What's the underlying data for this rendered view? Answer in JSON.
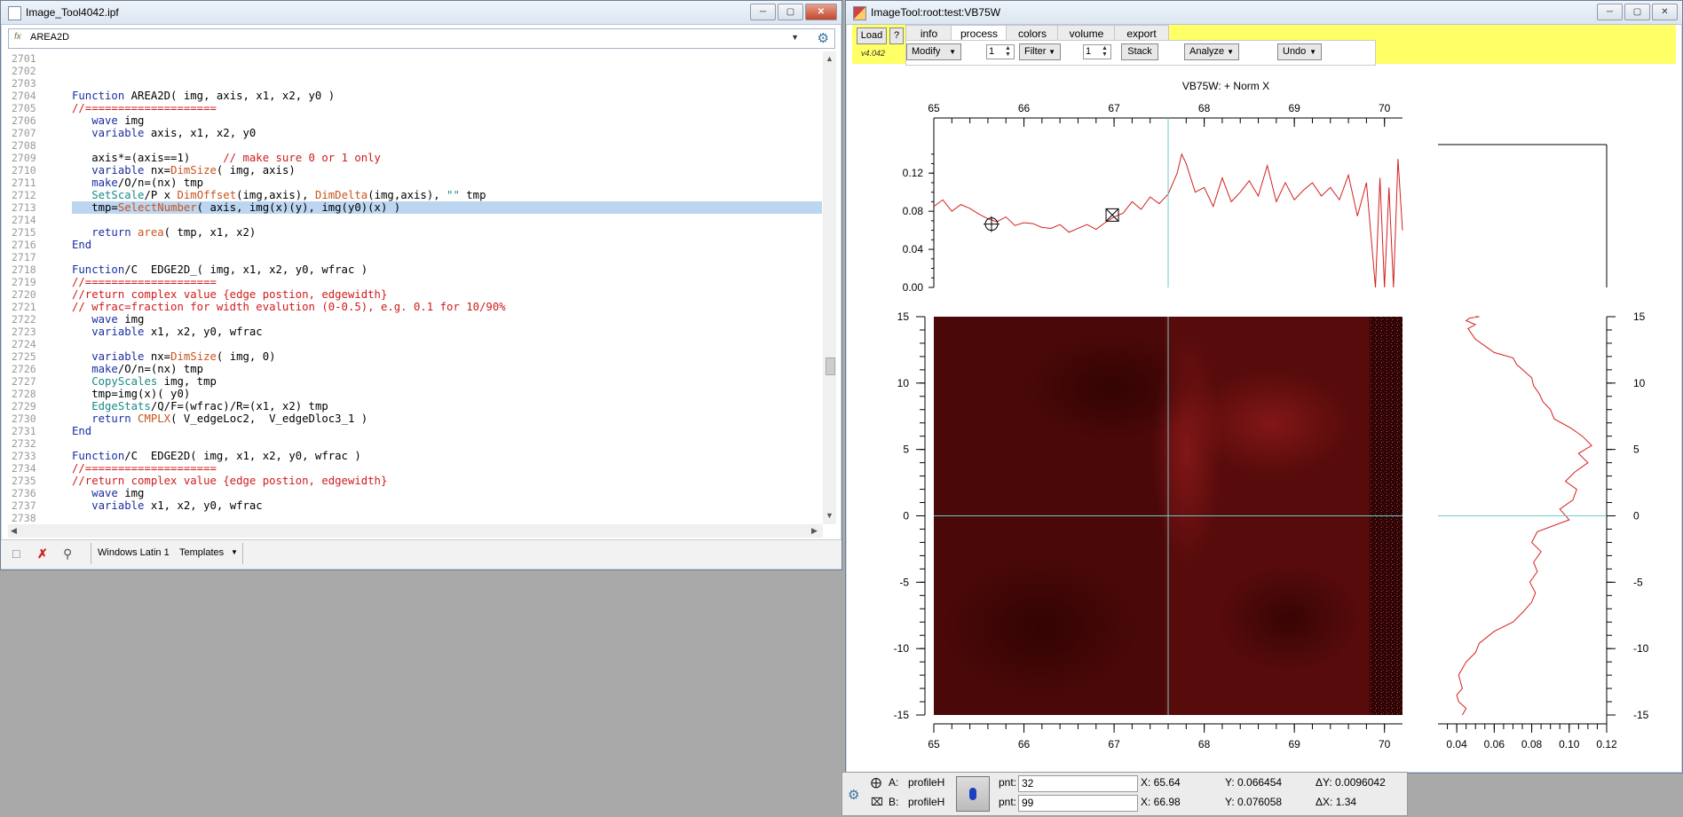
{
  "procedure_window": {
    "title": "Image_Tool4042.ipf",
    "function_selector": {
      "fx_label": "fx",
      "value": "AREA2D"
    },
    "lines": [
      {
        "n": "2701",
        "segs": []
      },
      {
        "n": "2702",
        "segs": []
      },
      {
        "n": "2703",
        "segs": []
      },
      {
        "n": "2704",
        "segs": [
          {
            "t": "Function",
            "c": "kw"
          },
          {
            "t": " AREA2D( img, axis, x1, x2, y0 )"
          }
        ]
      },
      {
        "n": "2705",
        "segs": [
          {
            "t": "//====================",
            "c": "cm"
          }
        ]
      },
      {
        "n": "2706",
        "segs": [
          {
            "t": "   "
          },
          {
            "t": "wave",
            "c": "kw"
          },
          {
            "t": " img"
          }
        ]
      },
      {
        "n": "2707",
        "segs": [
          {
            "t": "   "
          },
          {
            "t": "variable",
            "c": "kw"
          },
          {
            "t": " axis, x1, x2, y0"
          }
        ]
      },
      {
        "n": "2708",
        "segs": []
      },
      {
        "n": "2709",
        "segs": [
          {
            "t": "   axis*=(axis==1)     "
          },
          {
            "t": "// make sure 0 or 1 only",
            "c": "cm"
          }
        ]
      },
      {
        "n": "2710",
        "segs": [
          {
            "t": "   "
          },
          {
            "t": "variable",
            "c": "kw"
          },
          {
            "t": " nx="
          },
          {
            "t": "DimSize",
            "c": "fn"
          },
          {
            "t": "( img, axis)"
          }
        ]
      },
      {
        "n": "2711",
        "segs": [
          {
            "t": "   "
          },
          {
            "t": "make",
            "c": "kw"
          },
          {
            "t": "/O/n=(nx) tmp"
          }
        ]
      },
      {
        "n": "2712",
        "segs": [
          {
            "t": "   "
          },
          {
            "t": "SetScale",
            "c": "fn2"
          },
          {
            "t": "/P x "
          },
          {
            "t": "DimOffset",
            "c": "fn"
          },
          {
            "t": "(img,axis), "
          },
          {
            "t": "DimDelta",
            "c": "fn"
          },
          {
            "t": "(img,axis), "
          },
          {
            "t": "\"\"",
            "c": "fn2"
          },
          {
            "t": " tmp"
          }
        ]
      },
      {
        "n": "2713",
        "hl": true,
        "segs": [
          {
            "t": "   tmp="
          },
          {
            "t": "SelectNumber",
            "c": "fn"
          },
          {
            "t": "( axis, img(x)(y), img(y0)(x) )"
          }
        ]
      },
      {
        "n": "2714",
        "segs": []
      },
      {
        "n": "2715",
        "segs": [
          {
            "t": "   "
          },
          {
            "t": "return",
            "c": "kw"
          },
          {
            "t": " "
          },
          {
            "t": "area",
            "c": "fn"
          },
          {
            "t": "( tmp, x1, x2)"
          }
        ]
      },
      {
        "n": "2716",
        "segs": [
          {
            "t": "End",
            "c": "kw"
          }
        ]
      },
      {
        "n": "2717",
        "segs": []
      },
      {
        "n": "2718",
        "segs": [
          {
            "t": "Function",
            "c": "kw"
          },
          {
            "t": "/C  EDGE2D_( img, x1, x2, y0, wfrac )"
          }
        ]
      },
      {
        "n": "2719",
        "segs": [
          {
            "t": "//====================",
            "c": "cm"
          }
        ]
      },
      {
        "n": "2720",
        "segs": [
          {
            "t": "//return complex value {edge postion, edgewidth}",
            "c": "cm"
          }
        ]
      },
      {
        "n": "2721",
        "segs": [
          {
            "t": "// wfrac=fraction for width evalution (0-0.5), e.g. 0.1 for 10/90%",
            "c": "cm"
          }
        ]
      },
      {
        "n": "2722",
        "segs": [
          {
            "t": "   "
          },
          {
            "t": "wave",
            "c": "kw"
          },
          {
            "t": " img"
          }
        ]
      },
      {
        "n": "2723",
        "segs": [
          {
            "t": "   "
          },
          {
            "t": "variable",
            "c": "kw"
          },
          {
            "t": " x1, x2, y0, wfrac"
          }
        ]
      },
      {
        "n": "2724",
        "segs": []
      },
      {
        "n": "2725",
        "segs": [
          {
            "t": "   "
          },
          {
            "t": "variable",
            "c": "kw"
          },
          {
            "t": " nx="
          },
          {
            "t": "DimSize",
            "c": "fn"
          },
          {
            "t": "( img, 0)"
          }
        ]
      },
      {
        "n": "2726",
        "segs": [
          {
            "t": "   "
          },
          {
            "t": "make",
            "c": "kw"
          },
          {
            "t": "/O/n=(nx) tmp"
          }
        ]
      },
      {
        "n": "2727",
        "segs": [
          {
            "t": "   "
          },
          {
            "t": "CopyScales",
            "c": "fn2"
          },
          {
            "t": " img, tmp"
          }
        ]
      },
      {
        "n": "2728",
        "segs": [
          {
            "t": "   tmp=img(x)( y0)"
          }
        ]
      },
      {
        "n": "2729",
        "segs": [
          {
            "t": "   "
          },
          {
            "t": "EdgeStats",
            "c": "fn2"
          },
          {
            "t": "/Q/F=(wfrac)/R=(x1, x2) tmp"
          }
        ]
      },
      {
        "n": "2730",
        "segs": [
          {
            "t": "   "
          },
          {
            "t": "return",
            "c": "kw"
          },
          {
            "t": " "
          },
          {
            "t": "CMPLX",
            "c": "fn"
          },
          {
            "t": "( V_edgeLoc2,  V_edgeDloc3_1 )"
          }
        ]
      },
      {
        "n": "2731",
        "segs": [
          {
            "t": "End",
            "c": "kw"
          }
        ]
      },
      {
        "n": "2732",
        "segs": []
      },
      {
        "n": "2733",
        "segs": [
          {
            "t": "Function",
            "c": "kw"
          },
          {
            "t": "/C  EDGE2D( img, x1, x2, y0, wfrac )"
          }
        ]
      },
      {
        "n": "2734",
        "segs": [
          {
            "t": "//====================",
            "c": "cm"
          }
        ]
      },
      {
        "n": "2735",
        "segs": [
          {
            "t": "//return complex value {edge postion, edgewidth}",
            "c": "cm"
          }
        ]
      },
      {
        "n": "2736",
        "segs": [
          {
            "t": "   "
          },
          {
            "t": "wave",
            "c": "kw"
          },
          {
            "t": " img"
          }
        ]
      },
      {
        "n": "2737",
        "segs": [
          {
            "t": "   "
          },
          {
            "t": "variable",
            "c": "kw"
          },
          {
            "t": " x1, x2, y0, wfrac"
          }
        ]
      },
      {
        "n": "2738",
        "segs": []
      }
    ],
    "status": {
      "encoding": "Windows Latin 1",
      "templates": "Templates"
    }
  },
  "image_tool": {
    "title": "ImageTool:root:test:VB75W",
    "load_label": "Load",
    "help_label": "?",
    "version": "v4.042",
    "tabs": [
      "info",
      "process",
      "colors",
      "volume",
      "export"
    ],
    "active_tab": "process",
    "modify_label": "Modify",
    "spin1_value": "1",
    "filter_label": "Filter",
    "spin2_value": "1",
    "stack_label": "Stack",
    "analyze_label": "Analyze",
    "undo_label": "Undo",
    "plot_title": "VB75W: + Norm X",
    "cursor_color": "#66cccc",
    "trace_color": "#d42020"
  },
  "readout": {
    "rows": [
      {
        "cursor": "A:",
        "wave": "profileH",
        "pnt_label": "pnt:",
        "pnt": "32",
        "x": "X: 65.64",
        "y": "Y: 0.066454",
        "delta": "ΔY: 0.0096042"
      },
      {
        "cursor": "B:",
        "wave": "profileH",
        "pnt_label": "pnt:",
        "pnt": "99",
        "x": "X: 66.98",
        "y": "Y: 0.076058",
        "delta": "ΔX: 1.34"
      }
    ]
  },
  "chart_data": [
    {
      "type": "line",
      "name": "horizontal-profile",
      "x_ticks": [
        65,
        66,
        67,
        68,
        69,
        70
      ],
      "y_ticks": [
        0.0,
        0.04,
        0.08,
        0.12
      ],
      "y_tick_labels": [
        "0.00",
        "0.04",
        "0.08",
        "0.12"
      ],
      "xlim": [
        65,
        70.2
      ],
      "ylim": [
        0,
        0.15
      ],
      "x": [
        65.0,
        65.1,
        65.2,
        65.3,
        65.4,
        65.5,
        65.6,
        65.7,
        65.8,
        65.9,
        66.0,
        66.1,
        66.2,
        66.3,
        66.4,
        66.5,
        66.6,
        66.7,
        66.8,
        66.9,
        67.0,
        67.1,
        67.2,
        67.3,
        67.4,
        67.5,
        67.6,
        67.7,
        67.75,
        67.8,
        67.9,
        68.0,
        68.1,
        68.2,
        68.3,
        68.4,
        68.5,
        68.6,
        68.7,
        68.8,
        68.9,
        69.0,
        69.1,
        69.2,
        69.3,
        69.4,
        69.5,
        69.6,
        69.7,
        69.8,
        69.9,
        69.95,
        70.0,
        70.05,
        70.1,
        70.15,
        70.2
      ],
      "y": [
        0.085,
        0.092,
        0.08,
        0.087,
        0.083,
        0.077,
        0.072,
        0.069,
        0.074,
        0.065,
        0.068,
        0.067,
        0.063,
        0.062,
        0.066,
        0.058,
        0.062,
        0.066,
        0.061,
        0.068,
        0.074,
        0.078,
        0.09,
        0.082,
        0.095,
        0.088,
        0.098,
        0.12,
        0.14,
        0.13,
        0.1,
        0.105,
        0.085,
        0.115,
        0.09,
        0.1,
        0.112,
        0.096,
        0.128,
        0.09,
        0.11,
        0.092,
        0.102,
        0.11,
        0.096,
        0.105,
        0.092,
        0.118,
        0.075,
        0.11,
        0.0,
        0.115,
        0.0,
        0.105,
        0.0,
        0.135,
        0.06
      ],
      "cursor_a": {
        "x": 65.64,
        "y": 0.066454
      },
      "cursor_b": {
        "x": 66.98,
        "y": 0.076058
      },
      "crosshair_x": 67.6
    },
    {
      "type": "heatmap",
      "name": "image",
      "x_ticks": [
        65,
        66,
        67,
        68,
        69,
        70
      ],
      "y_ticks": [
        -15,
        -10,
        -5,
        0,
        5,
        10,
        15
      ],
      "xlim": [
        65,
        70.2
      ],
      "ylim": [
        -15,
        15
      ],
      "crosshair": {
        "x": 67.6,
        "y": 0
      }
    },
    {
      "type": "line",
      "name": "vertical-profile",
      "x_ticks": [
        0.04,
        0.06,
        0.08,
        0.1,
        0.12
      ],
      "x_tick_labels": [
        "0.04",
        "0.06",
        "0.08",
        "0.10",
        "0.12"
      ],
      "y_ticks": [
        -15,
        -10,
        -5,
        0,
        5,
        10,
        15
      ],
      "xlim": [
        0.03,
        0.12
      ],
      "ylim": [
        -15,
        15
      ],
      "x": [
        0.043,
        0.045,
        0.041,
        0.04,
        0.043,
        0.041,
        0.045,
        0.05,
        0.052,
        0.06,
        0.07,
        0.075,
        0.08,
        0.082,
        0.079,
        0.083,
        0.081,
        0.085,
        0.08,
        0.083,
        0.1,
        0.095,
        0.102,
        0.104,
        0.098,
        0.103,
        0.11,
        0.105,
        0.112,
        0.107,
        0.101,
        0.092,
        0.09,
        0.086,
        0.084,
        0.081,
        0.08,
        0.076,
        0.072,
        0.07,
        0.06,
        0.055,
        0.05,
        0.048,
        0.046,
        0.05,
        0.045,
        0.047,
        0.052,
        0.05
      ],
      "y": [
        -15,
        -14.5,
        -14,
        -13.5,
        -13,
        -12,
        -11,
        -10.3,
        -9.6,
        -8.7,
        -8,
        -7.3,
        -6.5,
        -5.8,
        -5,
        -4.2,
        -3.5,
        -2.7,
        -2,
        -1.2,
        -0.3,
        0.5,
        1.2,
        2,
        2.6,
        3.3,
        4,
        4.7,
        5.3,
        6,
        6.6,
        7.3,
        8,
        8.6,
        9.2,
        9.8,
        10.4,
        10.9,
        11.4,
        11.9,
        12.3,
        12.8,
        13.3,
        13.7,
        14.1,
        14.4,
        14.7,
        14.9,
        15,
        15
      ],
      "crosshair_y": 0
    }
  ]
}
